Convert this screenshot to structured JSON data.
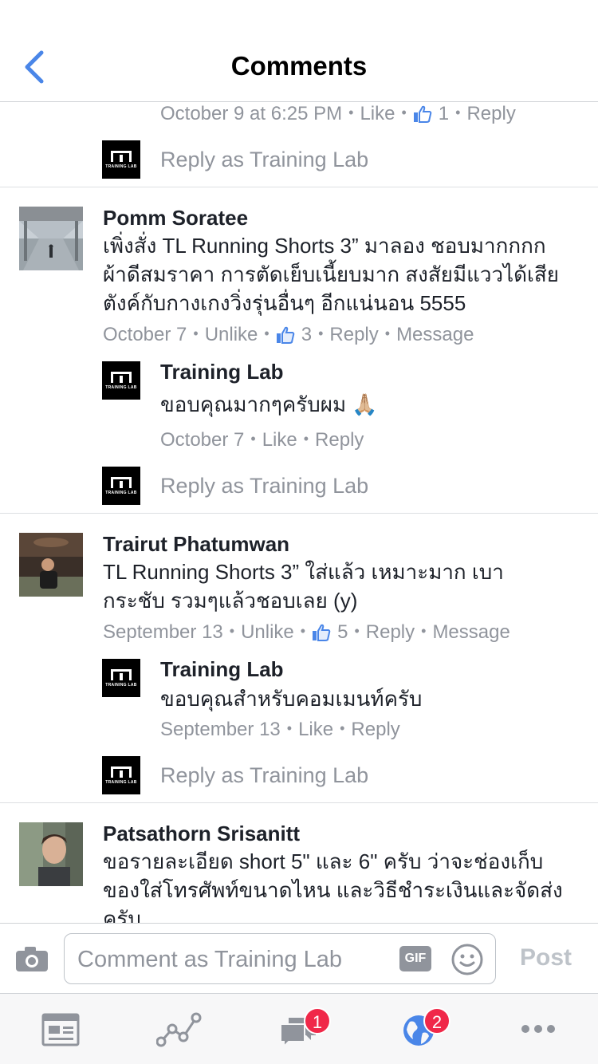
{
  "header": {
    "title": "Comments"
  },
  "top_meta": {
    "time": "October 9 at 6:25 PM",
    "like": "Like",
    "count": "1",
    "reply": "Reply"
  },
  "reply_as": "Reply as Training Lab",
  "page_name": "Training Lab",
  "logo_text": "TRAINING LAB",
  "comments": [
    {
      "name": "Pomm Soratee",
      "lines": [
        "เพิ่งสั่ง TL Running Shorts 3” มาลอง ชอบมากกกก",
        "ผ้าดีสมราคา การตัดเย็บเนี้ยบมาก สงสัยมีแววได้เสีย",
        "ตังค์กับกางเกงวิ่งรุ่นอื่นๆ อีกแน่นอน 5555"
      ],
      "time": "October 7",
      "action": "Unlike",
      "count": "3",
      "reply": "Reply",
      "message": "Message",
      "reply_item": {
        "text": "ขอบคุณมากๆครับผม 🙏🏼",
        "time": "October 7",
        "action": "Like",
        "reply": "Reply"
      }
    },
    {
      "name": "Trairut Phatumwan",
      "lines": [
        "TL Running Shorts 3”  ใส่แล้ว เหมาะมาก เบา",
        "กระชับ รวมๆแล้วชอบเลย (y)"
      ],
      "time": "September 13",
      "action": "Unlike",
      "count": "5",
      "reply": "Reply",
      "message": "Message",
      "reply_item": {
        "text": "ขอบคุณสำหรับคอมเมนท์ครับ",
        "time": "September 13",
        "action": "Like",
        "reply": "Reply"
      }
    },
    {
      "name": "Patsathorn Srisanitt",
      "lines": [
        "ขอรายละเอียด short 5\" และ 6\" ครับ ว่าจะช่องเก็บ",
        "ของใส่โทรศัพท์ขนาดไหน และวิธีชำระเงินและจัดส่ง",
        "ครับ"
      ]
    }
  ],
  "composer": {
    "placeholder": "Comment as Training Lab",
    "gif": "GIF",
    "post": "Post"
  },
  "tabs": [
    {
      "icon": "news-feed-icon"
    },
    {
      "icon": "insights-icon"
    },
    {
      "icon": "messages-icon",
      "badge": "1"
    },
    {
      "icon": "notifications-globe-icon",
      "badge": "2"
    },
    {
      "icon": "more-icon"
    }
  ],
  "colors": {
    "accent": "#4a86e8",
    "meta": "#90949c",
    "badge": "#f02849"
  }
}
